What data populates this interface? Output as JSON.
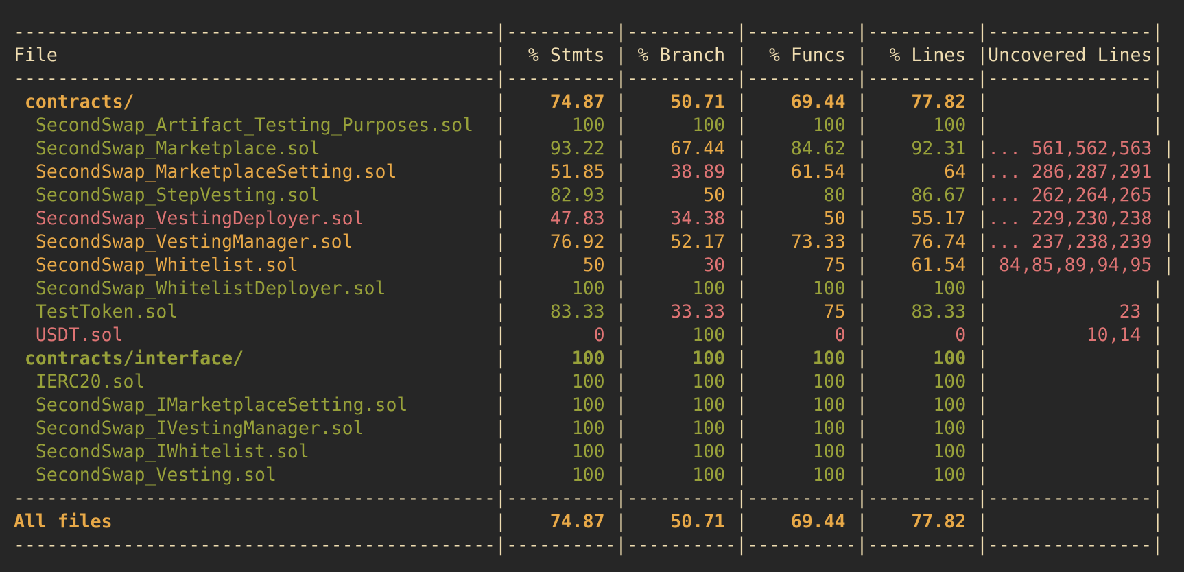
{
  "colors": {
    "background": "#262626",
    "separator": "#eedcb0",
    "high": "#98a13a",
    "medium": "#e8a948",
    "low": "#df7474"
  },
  "header": {
    "file": "File",
    "stmts": "% Stmts",
    "branch": "% Branch",
    "funcs": "% Funcs",
    "lines": "% Lines",
    "uncovered": "Uncovered Lines"
  },
  "rows": [
    {
      "file": " contracts/",
      "indent": 1,
      "stmts": "74.87",
      "branch": "50.71",
      "funcs": "69.44",
      "lines": "77.82",
      "uncovered": "",
      "level": "mid",
      "bold": true,
      "levels": {
        "stmts": "mid",
        "branch": "mid",
        "funcs": "mid",
        "lines": "mid",
        "uncovered": "lo"
      }
    },
    {
      "file": "  SecondSwap_Artifact_Testing_Purposes.sol",
      "stmts": "100",
      "branch": "100",
      "funcs": "100",
      "lines": "100",
      "uncovered": "",
      "level": "hi",
      "levels": {
        "stmts": "hi",
        "branch": "hi",
        "funcs": "hi",
        "lines": "hi",
        "uncovered": "lo"
      }
    },
    {
      "file": "  SecondSwap_Marketplace.sol",
      "stmts": "93.22",
      "branch": "67.44",
      "funcs": "84.62",
      "lines": "92.31",
      "uncovered": "... 561,562,563",
      "level": "hi",
      "levels": {
        "stmts": "hi",
        "branch": "mid",
        "funcs": "hi",
        "lines": "hi",
        "uncovered": "lo"
      }
    },
    {
      "file": "  SecondSwap_MarketplaceSetting.sol",
      "stmts": "51.85",
      "branch": "38.89",
      "funcs": "61.54",
      "lines": "64",
      "uncovered": "... 286,287,291",
      "level": "mid",
      "levels": {
        "stmts": "mid",
        "branch": "lo",
        "funcs": "mid",
        "lines": "mid",
        "uncovered": "lo"
      }
    },
    {
      "file": "  SecondSwap_StepVesting.sol",
      "stmts": "82.93",
      "branch": "50",
      "funcs": "80",
      "lines": "86.67",
      "uncovered": "... 262,264,265",
      "level": "hi",
      "levels": {
        "stmts": "hi",
        "branch": "mid",
        "funcs": "hi",
        "lines": "hi",
        "uncovered": "lo"
      }
    },
    {
      "file": "  SecondSwap_VestingDeployer.sol",
      "stmts": "47.83",
      "branch": "34.38",
      "funcs": "50",
      "lines": "55.17",
      "uncovered": "... 229,230,238",
      "level": "lo",
      "levels": {
        "stmts": "lo",
        "branch": "lo",
        "funcs": "mid",
        "lines": "mid",
        "uncovered": "lo"
      }
    },
    {
      "file": "  SecondSwap_VestingManager.sol",
      "stmts": "76.92",
      "branch": "52.17",
      "funcs": "73.33",
      "lines": "76.74",
      "uncovered": "... 237,238,239",
      "level": "mid",
      "levels": {
        "stmts": "mid",
        "branch": "mid",
        "funcs": "mid",
        "lines": "mid",
        "uncovered": "lo"
      }
    },
    {
      "file": "  SecondSwap_Whitelist.sol",
      "stmts": "50",
      "branch": "30",
      "funcs": "75",
      "lines": "61.54",
      "uncovered": " 84,85,89,94,95",
      "level": "mid",
      "levels": {
        "stmts": "mid",
        "branch": "lo",
        "funcs": "mid",
        "lines": "mid",
        "uncovered": "lo"
      }
    },
    {
      "file": "  SecondSwap_WhitelistDeployer.sol",
      "stmts": "100",
      "branch": "100",
      "funcs": "100",
      "lines": "100",
      "uncovered": "",
      "level": "hi",
      "levels": {
        "stmts": "hi",
        "branch": "hi",
        "funcs": "hi",
        "lines": "hi",
        "uncovered": "lo"
      }
    },
    {
      "file": "  TestToken.sol",
      "stmts": "83.33",
      "branch": "33.33",
      "funcs": "75",
      "lines": "83.33",
      "uncovered": "23",
      "level": "hi",
      "levels": {
        "stmts": "hi",
        "branch": "lo",
        "funcs": "mid",
        "lines": "hi",
        "uncovered": "lo"
      }
    },
    {
      "file": "  USDT.sol",
      "stmts": "0",
      "branch": "100",
      "funcs": "0",
      "lines": "0",
      "uncovered": "10,14",
      "level": "lo",
      "levels": {
        "stmts": "lo",
        "branch": "hi",
        "funcs": "lo",
        "lines": "lo",
        "uncovered": "lo"
      }
    },
    {
      "file": " contracts/interface/",
      "stmts": "100",
      "branch": "100",
      "funcs": "100",
      "lines": "100",
      "uncovered": "",
      "level": "hi",
      "bold": true,
      "levels": {
        "stmts": "hi",
        "branch": "hi",
        "funcs": "hi",
        "lines": "hi",
        "uncovered": "lo"
      }
    },
    {
      "file": "  IERC20.sol",
      "stmts": "100",
      "branch": "100",
      "funcs": "100",
      "lines": "100",
      "uncovered": "",
      "level": "hi",
      "levels": {
        "stmts": "hi",
        "branch": "hi",
        "funcs": "hi",
        "lines": "hi",
        "uncovered": "lo"
      }
    },
    {
      "file": "  SecondSwap_IMarketplaceSetting.sol",
      "stmts": "100",
      "branch": "100",
      "funcs": "100",
      "lines": "100",
      "uncovered": "",
      "level": "hi",
      "levels": {
        "stmts": "hi",
        "branch": "hi",
        "funcs": "hi",
        "lines": "hi",
        "uncovered": "lo"
      }
    },
    {
      "file": "  SecondSwap_IVestingManager.sol",
      "stmts": "100",
      "branch": "100",
      "funcs": "100",
      "lines": "100",
      "uncovered": "",
      "level": "hi",
      "levels": {
        "stmts": "hi",
        "branch": "hi",
        "funcs": "hi",
        "lines": "hi",
        "uncovered": "lo"
      }
    },
    {
      "file": "  SecondSwap_IWhitelist.sol",
      "stmts": "100",
      "branch": "100",
      "funcs": "100",
      "lines": "100",
      "uncovered": "",
      "level": "hi",
      "levels": {
        "stmts": "hi",
        "branch": "hi",
        "funcs": "hi",
        "lines": "hi",
        "uncovered": "lo"
      }
    },
    {
      "file": "  SecondSwap_Vesting.sol",
      "stmts": "100",
      "branch": "100",
      "funcs": "100",
      "lines": "100",
      "uncovered": "",
      "level": "hi",
      "levels": {
        "stmts": "hi",
        "branch": "hi",
        "funcs": "hi",
        "lines": "hi",
        "uncovered": "lo"
      }
    }
  ],
  "total": {
    "file": "All files",
    "stmts": "74.87",
    "branch": "50.71",
    "funcs": "69.44",
    "lines": "77.82",
    "uncovered": "",
    "level": "mid",
    "bold": true,
    "levels": {
      "stmts": "mid",
      "branch": "mid",
      "funcs": "mid",
      "lines": "mid",
      "uncovered": "lo"
    }
  }
}
